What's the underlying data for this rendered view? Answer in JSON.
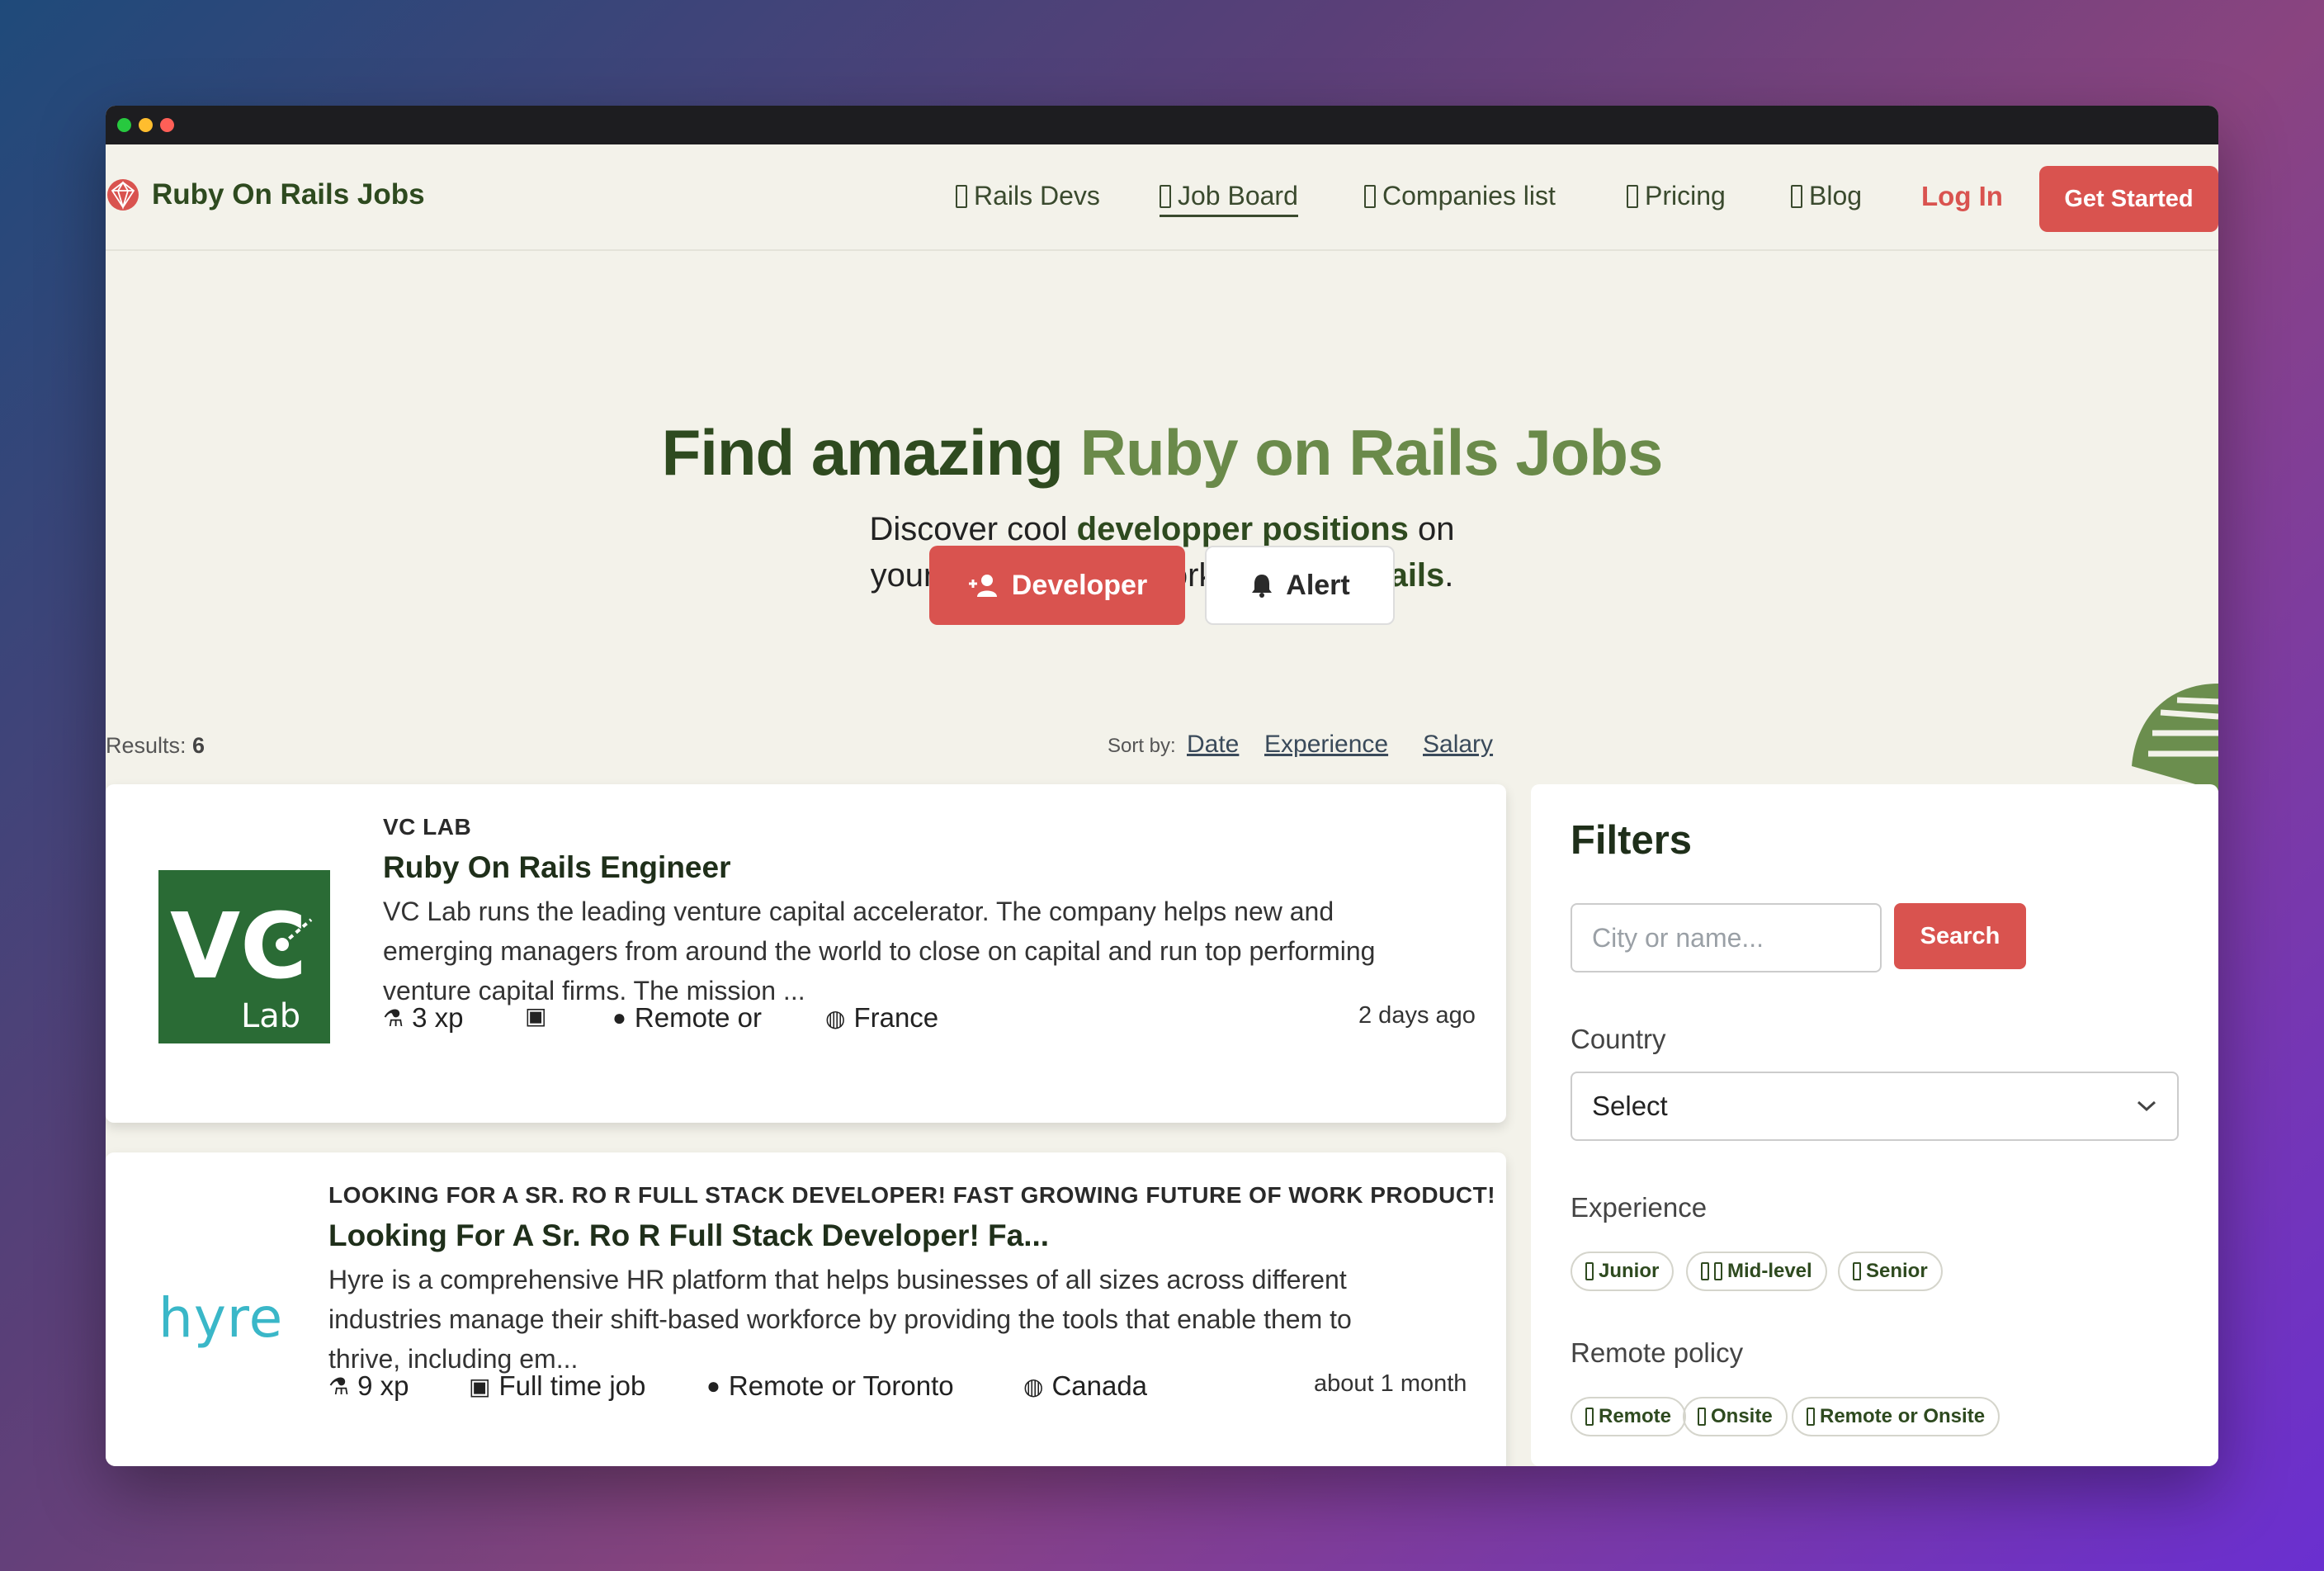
{
  "brand": {
    "name": "Ruby On Rails Jobs"
  },
  "nav": {
    "items": [
      {
        "label": "Rails Devs"
      },
      {
        "label": "Job Board"
      },
      {
        "label": "Companies list"
      },
      {
        "label": "Pricing"
      },
      {
        "label": "Blog"
      }
    ],
    "login": "Log In",
    "cta": "Get Started"
  },
  "hero": {
    "title_a": "Find amazing ",
    "title_b": "Ruby on Rails Jobs",
    "sub_1a": "Discover cool ",
    "sub_1b": "developper positions",
    "sub_1c": " on",
    "sub_2a": "your favorite framework ",
    "sub_2b": "Ruby on Rails",
    "sub_2c": ".",
    "btn_developer": "Developer",
    "btn_alert": "Alert"
  },
  "results": {
    "label": "Results: ",
    "count": "6"
  },
  "sort": {
    "label": "Sort by:",
    "options": [
      "Date",
      "Experience",
      "Salary"
    ]
  },
  "jobs": [
    {
      "logo_text_1": "VC",
      "logo_text_2": "Lab",
      "company": "VC LAB",
      "title": "Ruby On Rails Engineer",
      "desc_1": "VC Lab runs the leading venture capital accelerator. The company helps new and",
      "desc_2": "emerging managers from around the world to close on capital and run top performing",
      "desc_3": "venture capital firms. The mission ...",
      "xp": "3 xp",
      "job_type": "",
      "remote": "Remote or",
      "country": "France",
      "posted": "2 days ago"
    },
    {
      "logo_text": "hyre",
      "company": "LOOKING FOR A SR. RO R FULL STACK DEVELOPER! FAST GROWING FUTURE OF WORK PRODUCT!",
      "title": "Looking For A Sr. Ro R Full Stack Developer! Fa...",
      "desc_1": "Hyre is a comprehensive HR platform that helps businesses of all sizes across different",
      "desc_2": "industries manage their shift-based workforce by providing the tools that enable them to",
      "desc_3": "thrive, including em...",
      "xp": "9 xp",
      "job_type": "Full time job",
      "remote": "Remote or Toronto",
      "country": "Canada",
      "posted": "about 1 month"
    }
  ],
  "filters": {
    "title": "Filters",
    "search_placeholder": "City or name...",
    "search_button": "Search",
    "country_label": "Country",
    "country_value": "Select",
    "experience_label": "Experience",
    "experience": [
      "Junior",
      "Mid-level",
      "Senior"
    ],
    "remote_label": "Remote policy",
    "remote": [
      "Remote",
      "Onsite",
      "Remote or Onsite"
    ]
  },
  "colors": {
    "accent": "#d9534f",
    "brand_green": "#2e4a1f",
    "light_green": "#6a8a4a"
  }
}
